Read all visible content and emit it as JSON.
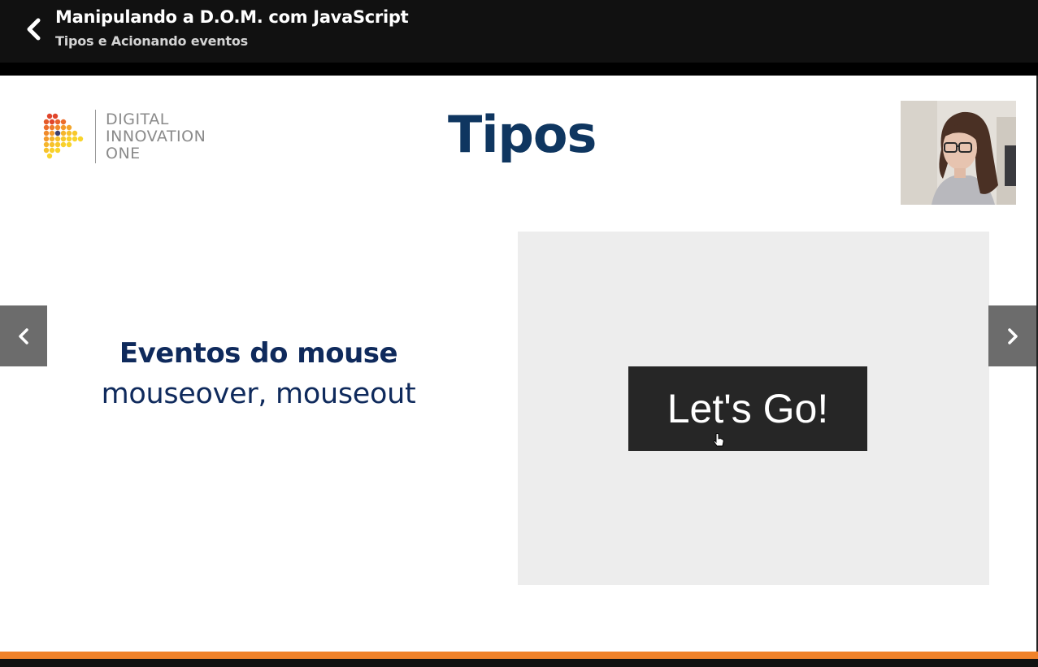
{
  "header": {
    "course_title": "Manipulando a D.O.M. com JavaScript",
    "lesson_title": "Tipos e Acionando eventos",
    "back_icon": "chevron-left-icon"
  },
  "slide": {
    "logo_lines": [
      "DIGITAL",
      "INNOVATION",
      "ONE"
    ],
    "title": "Tipos",
    "event_heading": "Eventos do mouse",
    "event_types": "mouseover, mouseout",
    "demo_button_label": "Let's Go!"
  },
  "navigation": {
    "prev_icon": "chevron-left-icon",
    "next_icon": "chevron-right-icon"
  },
  "progress": {
    "fraction": 1.0
  },
  "colors": {
    "accent": "#f0822a",
    "title_navy": "#0f3660",
    "heading_navy": "#0f2a5c",
    "demo_panel": "#ededed",
    "demo_button": "#262626"
  }
}
